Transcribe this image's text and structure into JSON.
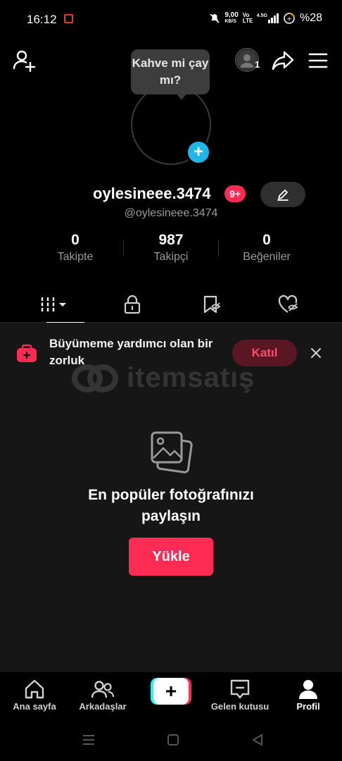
{
  "status_bar": {
    "time": "16:12",
    "network_speed": "9,00",
    "network_speed_unit": "KB/S",
    "volte": "Vo LTE",
    "signal_label": "4.5G",
    "battery": "%28"
  },
  "top_bar": {
    "avatar_badge": "1"
  },
  "profile": {
    "bubble_text": "Kahve mi çay mı?",
    "username": "oylesineee.3474",
    "notif_badge": "9+",
    "handle": "@oylesineee.3474",
    "stats": [
      {
        "value": "0",
        "label": "Takipte"
      },
      {
        "value": "987",
        "label": "Takipçi"
      },
      {
        "value": "0",
        "label": "Beğeniler"
      }
    ]
  },
  "tabs": [
    {
      "icon": "grid-icon",
      "active": true
    },
    {
      "icon": "lock-icon",
      "active": false
    },
    {
      "icon": "bookmark-hidden-icon",
      "active": false
    },
    {
      "icon": "heart-hidden-icon",
      "active": false
    }
  ],
  "challenge": {
    "text": "Büyümeme yardımcı olan bir zorluk",
    "join_label": "Katıl"
  },
  "watermark": {
    "text": "itemsatış"
  },
  "empty_state": {
    "title": "En popüler fotoğrafınızı paylaşın",
    "upload_label": "Yükle"
  },
  "bottom_nav": {
    "items": [
      {
        "label": "Ana sayfa",
        "icon": "home-icon"
      },
      {
        "label": "Arkadaşlar",
        "icon": "friends-icon"
      },
      {
        "label": "Gelen kutusu",
        "icon": "inbox-icon"
      },
      {
        "label": "Profil",
        "icon": "profile-icon",
        "active": true
      }
    ]
  },
  "colors": {
    "accent": "#fe2c55",
    "cyan": "#25f4ee",
    "avatar_plus": "#20b6e6",
    "background": "#000000",
    "content_bg": "#161616"
  }
}
